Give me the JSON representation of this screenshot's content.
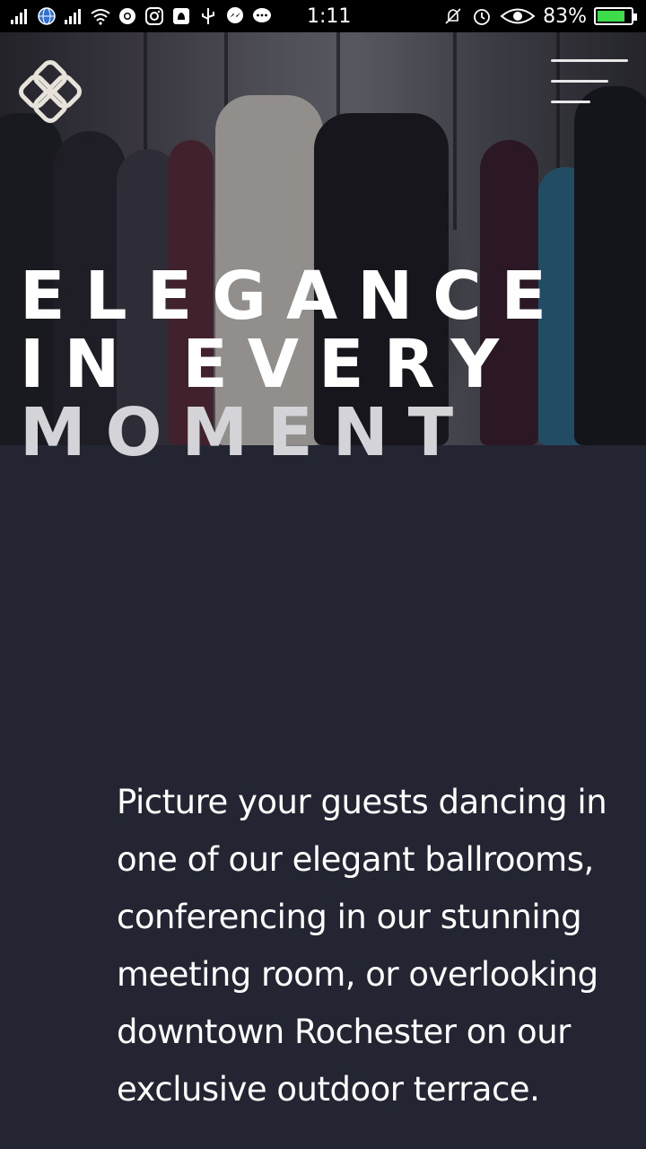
{
  "status_bar": {
    "time": "1:11",
    "battery": "83%",
    "battery_level": 0.83,
    "icons_left": [
      "signal-icon",
      "globe-icon",
      "signal-icon",
      "wifi-icon",
      "chrome-icon",
      "instagram-icon",
      "notification-icon",
      "usb-icon",
      "messenger-icon",
      "chat-icon"
    ],
    "icons_right": [
      "mute-icon",
      "alarm-icon",
      "eye-icon",
      "battery-icon"
    ]
  },
  "header": {
    "logo_icon": "knot-logo-icon",
    "menu_icon": "hamburger-menu-icon"
  },
  "hero": {
    "headline_line1": "ELEGANCE",
    "headline_line2": "IN EVERY",
    "headline_line3": "MOMENT"
  },
  "intro": {
    "text": "Picture your guests dancing in one of our elegant ballrooms, conferencing in our stunning meeting room, or overlooking downtown Rochester on our exclusive outdoor terrace."
  },
  "colors": {
    "background": "#232533",
    "text": "#ffffff",
    "battery_fill": "#3ddc4a"
  }
}
